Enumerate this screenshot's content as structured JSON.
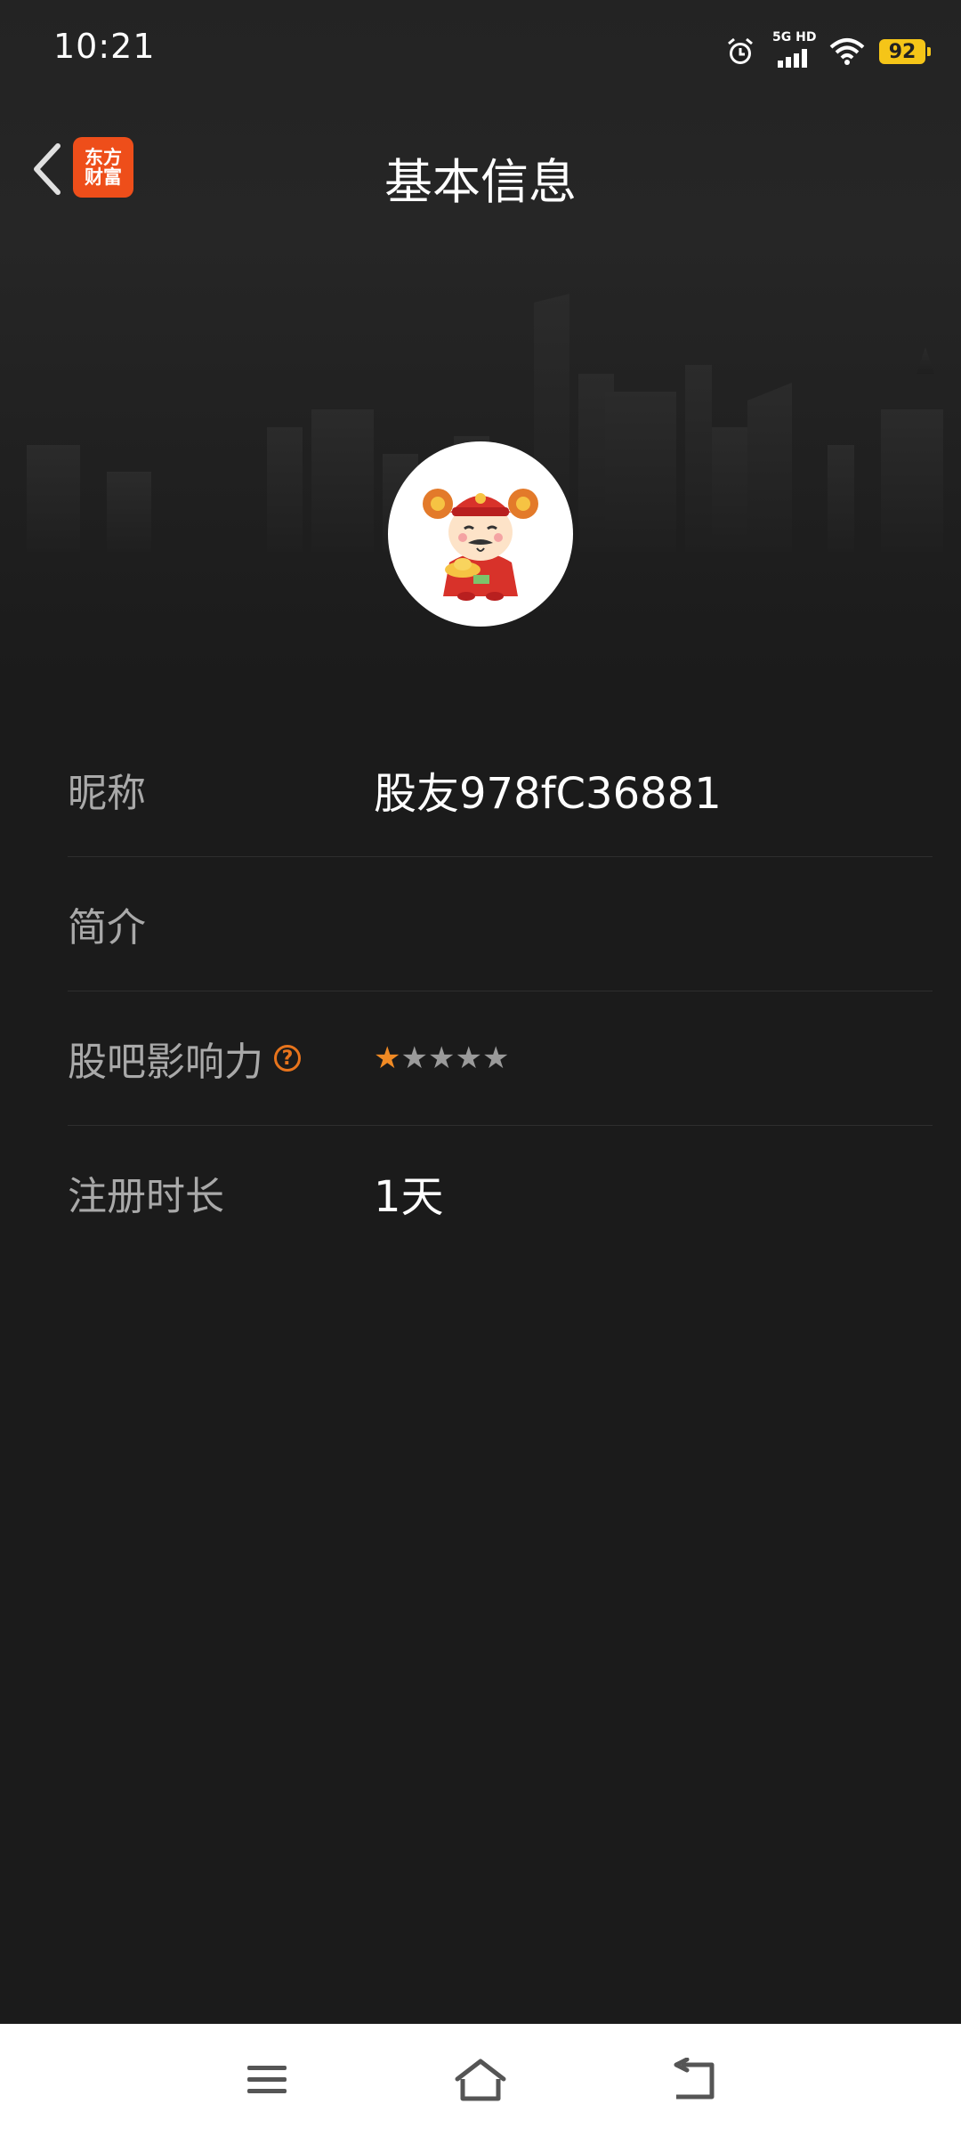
{
  "status_bar": {
    "time": "10:21",
    "network": "5G HD",
    "battery": "92"
  },
  "header": {
    "title": "基本信息",
    "logo_line1": "东方",
    "logo_line2": "财富"
  },
  "profile": {
    "rows": [
      {
        "label": "昵称",
        "value": "股友978fC36881"
      },
      {
        "label": "简介",
        "value": ""
      },
      {
        "label": "股吧影响力",
        "rating": 1,
        "rating_max": 5
      },
      {
        "label": "注册时长",
        "value": "1天"
      }
    ]
  },
  "colors": {
    "background": "#1b1b1b",
    "accent_orange": "#e8741c",
    "logo_orange": "#ee4e1a",
    "battery_yellow": "#f5c518"
  },
  "icons": {
    "help": "?",
    "star": "★"
  },
  "nav_bar": {
    "items": [
      "menu-icon",
      "home-icon",
      "back-icon"
    ]
  }
}
